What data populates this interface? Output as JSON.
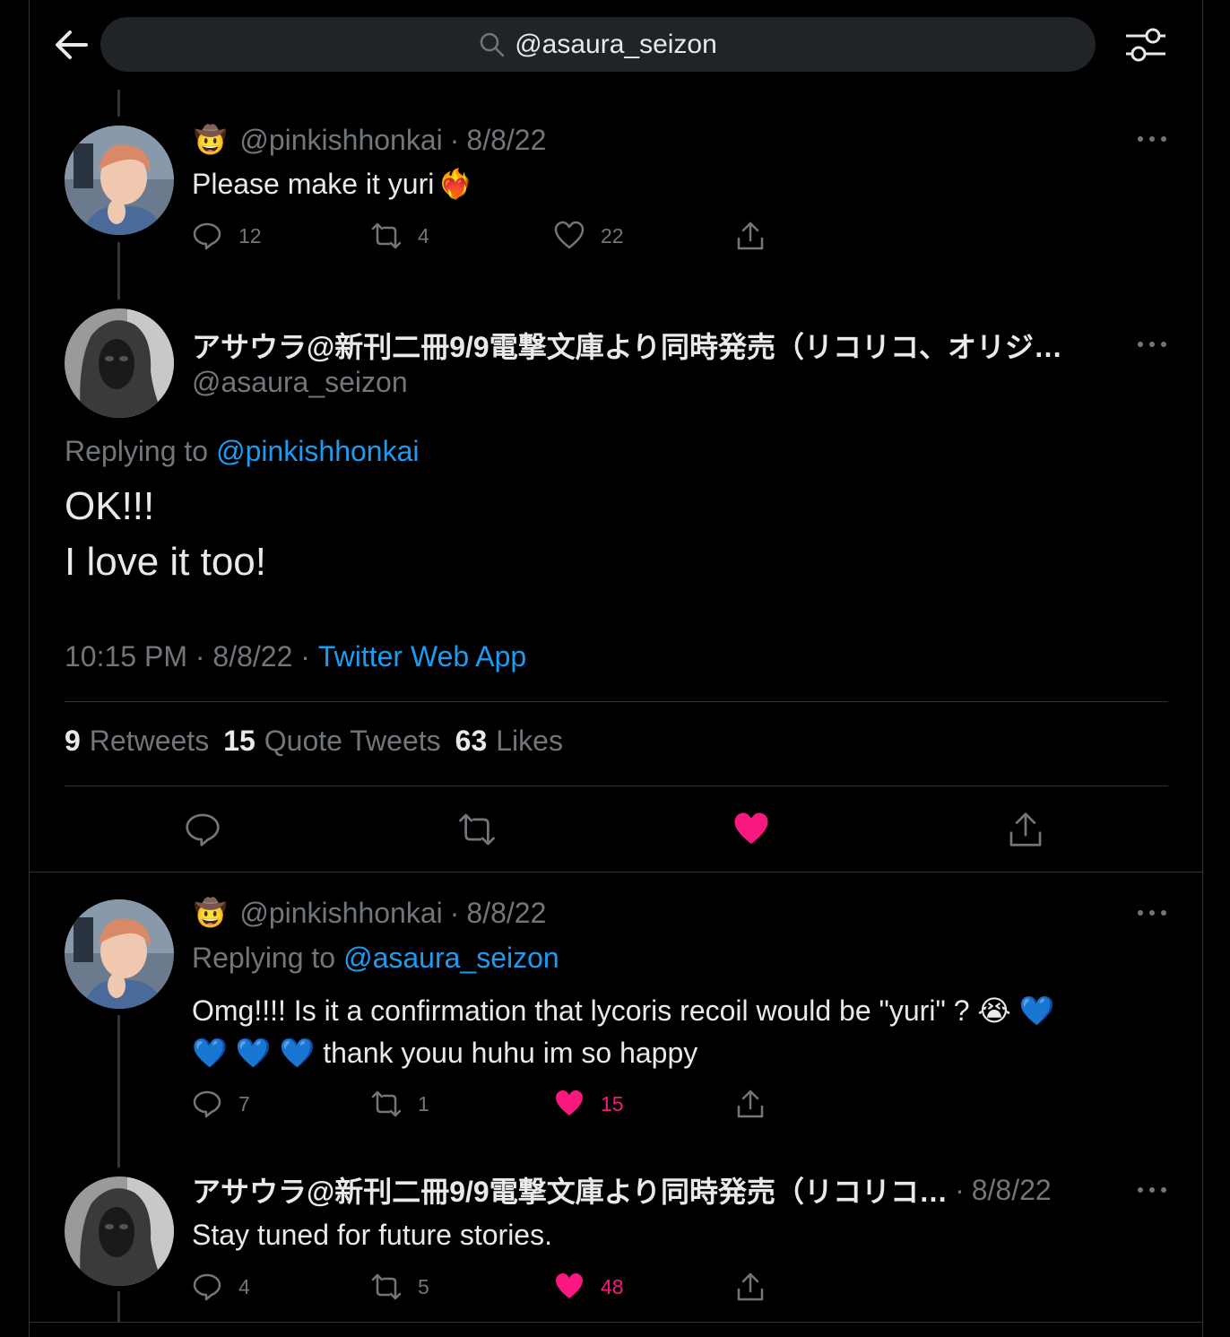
{
  "search": {
    "query": "@asaura_seizon"
  },
  "tweet1": {
    "emoji": "🤠",
    "handle": "@pinkishhonkai",
    "date": "8/8/22",
    "text": "Please make it yuri",
    "heart_emoji": "❤️‍🔥",
    "replies": "12",
    "retweets": "4",
    "likes": "22"
  },
  "main": {
    "name": "アサウラ@新刊二冊9/9電撃文庫より同時発売（リコリコ、オリジ…",
    "handle": "@asaura_seizon",
    "replying_label": "Replying to",
    "replying_to": "@pinkishhonkai",
    "line1": "OK!!!",
    "line2": "I love it too!",
    "time": "10:15 PM · 8/8/22 · ",
    "source": "Twitter Web App",
    "retweets_count": "9",
    "retweets_label": "Retweets",
    "quotes_count": "15",
    "quotes_label": "Quote Tweets",
    "likes_count": "63",
    "likes_label": "Likes"
  },
  "tweet2": {
    "emoji": "🤠",
    "handle": "@pinkishhonkai",
    "date": "8/8/22",
    "replying_label": "Replying to",
    "replying_to": "@asaura_seizon",
    "line1": "Omg!!!! Is it a confirmation that lycoris recoil would be \"yuri\" ? 😭 💙",
    "line2": "💙 💙 💙 thank youu huhu im so happy",
    "replies": "7",
    "retweets": "1",
    "likes": "15"
  },
  "tweet3": {
    "name": "アサウラ@新刊二冊9/9電撃文庫より同時発売（リコリコ…",
    "date": "8/8/22",
    "text": "Stay tuned for future stories.",
    "replies": "4",
    "retweets": "5",
    "likes": "48"
  },
  "colors": {
    "accent": "#1d9bf0",
    "like": "#f91880",
    "muted": "#71767b",
    "text": "#e7e9ea"
  },
  "icons": [
    "back-arrow-icon",
    "search-icon",
    "filter-icon",
    "reply-icon",
    "retweet-icon",
    "heart-icon",
    "share-icon",
    "more-icon"
  ]
}
